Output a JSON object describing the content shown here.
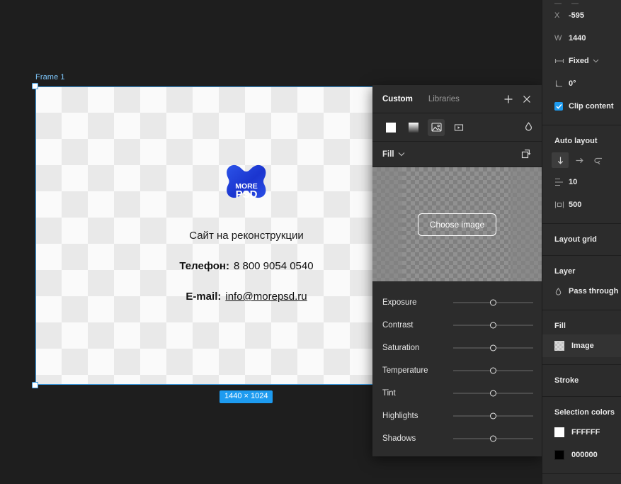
{
  "canvas": {
    "frame_label": "Frame 1",
    "size_badge": "1440 × 1024",
    "content": {
      "logo_line1": "MORE",
      "logo_line2": "PSD",
      "tagline": "Сайт на реконструкции",
      "phone_label": "Телефон:",
      "phone_value": "8 800 9054 0540",
      "email_label": "E-mail:",
      "email_value": "info@morepsd.ru"
    }
  },
  "fill_panel": {
    "tabs": [
      {
        "label": "Custom",
        "active": true
      },
      {
        "label": "Libraries",
        "active": false
      }
    ],
    "add_label": "add-icon",
    "close_label": "close-icon",
    "fill_types": [
      {
        "name": "solid",
        "selected": false
      },
      {
        "name": "gradient",
        "selected": false
      },
      {
        "name": "image",
        "selected": true
      },
      {
        "name": "video",
        "selected": false
      }
    ],
    "blend_icon": "droplet-icon",
    "fill_row": {
      "label": "Fill",
      "chevron": "⌄",
      "swap_icon": "rotate-icon"
    },
    "preview": {
      "choose_button": "Choose image"
    },
    "adjustments": [
      {
        "label": "Exposure",
        "value": 50
      },
      {
        "label": "Contrast",
        "value": 50
      },
      {
        "label": "Saturation",
        "value": 50
      },
      {
        "label": "Temperature",
        "value": 50
      },
      {
        "label": "Tint",
        "value": 50
      },
      {
        "label": "Highlights",
        "value": 50
      },
      {
        "label": "Shadows",
        "value": 50
      }
    ]
  },
  "sidebar": {
    "position": {
      "x_label": "X",
      "x_value": "-595",
      "w_label": "W",
      "w_value": "1440",
      "sizing_icon": "horizontal-resize-icon",
      "sizing_value": "Fixed",
      "rotation_icon": "angle-icon",
      "rotation_value": "0°",
      "clip_content_label": "Clip content",
      "clip_content_checked": true
    },
    "auto_layout": {
      "title": "Auto layout",
      "directions": [
        {
          "name": "vertical",
          "selected": true
        },
        {
          "name": "horizontal",
          "selected": false
        },
        {
          "name": "wrap",
          "selected": false
        }
      ],
      "gap_icon": "gap-icon",
      "gap_value": "10",
      "padding_icon": "padding-icon",
      "padding_value": "500"
    },
    "layout_grid": {
      "title": "Layout grid"
    },
    "layer": {
      "title": "Layer",
      "blend_icon": "droplet-icon",
      "blend_mode": "Pass through"
    },
    "fill": {
      "title": "Fill",
      "value": "Image"
    },
    "stroke": {
      "title": "Stroke"
    },
    "selection_colors": {
      "title": "Selection colors",
      "items": [
        {
          "hex": "FFFFFF",
          "color": "#ffffff"
        },
        {
          "hex": "000000",
          "color": "#000000"
        }
      ]
    }
  },
  "colors": {
    "accent_blue": "#1d9bf0",
    "logo_blue": "#1f3fd8",
    "panel_bg": "#2c2c2c",
    "canvas_bg": "#1e1e1e"
  }
}
